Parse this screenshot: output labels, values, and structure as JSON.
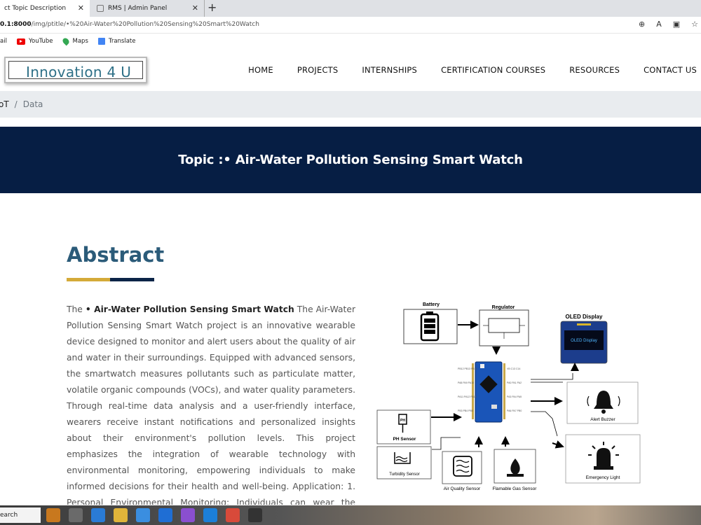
{
  "browser": {
    "tabs": [
      {
        "title": "ct Topic Description",
        "active": true
      },
      {
        "title": "RMS | Admin Panel",
        "active": false
      }
    ],
    "url_host": "0.1:8000",
    "url_path": "/img/ptitle/•%20Air-Water%20Pollution%20Sensing%20Smart%20Watch",
    "bookmarks": [
      "ail",
      "YouTube",
      "Maps",
      "Translate"
    ]
  },
  "site": {
    "logo": "Innovation 4 U",
    "nav": [
      "HOME",
      "PROJECTS",
      "INTERNSHIPS",
      "CERTIFICATION COURSES",
      "RESOURCES",
      "CONTACT US"
    ],
    "breadcrumb": {
      "parent": "oT",
      "current": "Data"
    },
    "banner_title": "Topic :• Air-Water Pollution Sensing Smart Watch"
  },
  "abstract": {
    "heading": "Abstract",
    "lead": "The ",
    "project_name": "• Air-Water Pollution Sensing Smart Watch",
    "body": " The Air-Water Pollution Sensing Smart Watch project is an innovative wearable device designed to monitor and alert users about the quality of air and water in their surroundings. Equipped with advanced sensors, the smartwatch measures pollutants such as particulate matter, volatile organic compounds (VOCs), and water quality parameters. Through real-time data analysis and a user-friendly interface, wearers receive instant notifications and personalized insights about their environment's pollution levels. This project emphasizes the integration of wearable technology with environmental monitoring, empowering individuals to make informed decisions for their health and well-being. Application: 1. Personal Environmental Monitoring: Individuals can wear the smart watch to continuously"
  },
  "diagram": {
    "battery": "Battery",
    "regulator": "Regulator",
    "oled_title": "OLED Display",
    "oled_screen": "OLED Display",
    "ph": "PH Sensor",
    "turbidity": "Turbidity Sensor",
    "air_quality": "Air Quality Sensor",
    "gas": "Flamable Gas Sensor",
    "buzzer": "Alert Buzzer",
    "light": "Emergency Light"
  },
  "taskbar": {
    "search": "earch"
  }
}
